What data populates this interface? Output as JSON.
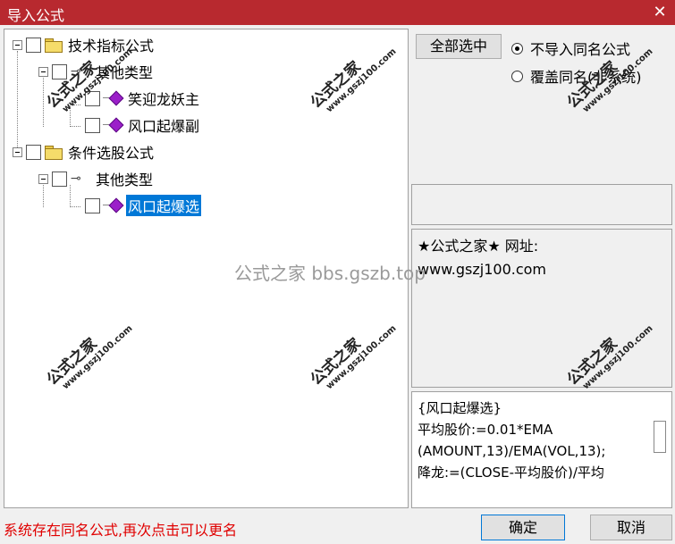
{
  "window": {
    "title": "导入公式",
    "close_glyph": "✕"
  },
  "tree": {
    "nodes": [
      {
        "label": "技术指标公式"
      },
      {
        "label": "其他类型"
      },
      {
        "label": "笑迎龙妖主"
      },
      {
        "label": "风口起爆副"
      },
      {
        "label": "条件选股公式"
      },
      {
        "label": "其他类型"
      },
      {
        "label": "风口起爆选"
      }
    ],
    "selected_index": 6
  },
  "buttons": {
    "select_all": "全部选中",
    "ok": "确定",
    "cancel": "取消"
  },
  "options": {
    "no_import_same": "不导入同名公式",
    "overwrite_same": "覆盖同名(非系统)",
    "selected": "no_import_same"
  },
  "info": {
    "line1": "★公式之家★ 网址:",
    "line2": "www.gszj100.com"
  },
  "code": {
    "lines": [
      "{风口起爆选}",
      "平均股价:=0.01*EMA",
      "(AMOUNT,13)/EMA(VOL,13);",
      "降龙:=(CLOSE-平均股价)/平均"
    ]
  },
  "status": {
    "message": "系统存在同名公式,再次点击可以更名"
  },
  "watermarks": {
    "center": "公式之家 bbs.gszb.top",
    "brand": "公式之家",
    "url": "www.gszj100.com"
  },
  "icons": {
    "folder": "folder-icon",
    "key": "key-icon",
    "formula": "formula-gem-icon"
  },
  "colors": {
    "titlebar": "#b8292f",
    "selection": "#0078d7",
    "status_text": "#e00000",
    "gem": "#9b1fc9"
  }
}
